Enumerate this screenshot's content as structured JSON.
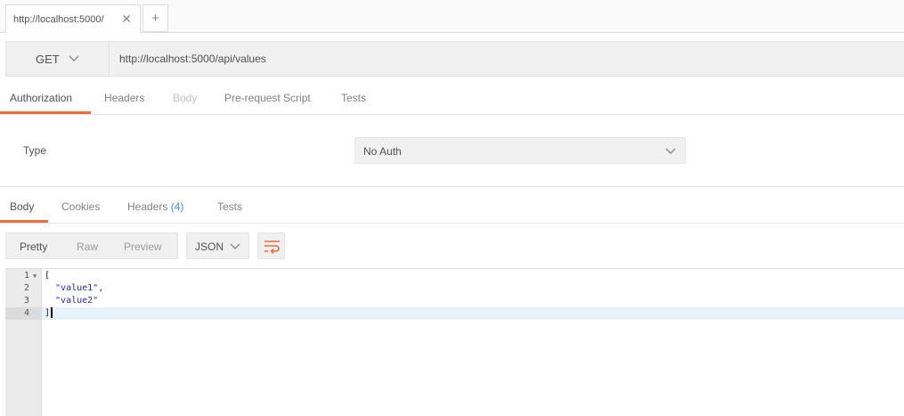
{
  "browser_tabs": [
    {
      "label": "http://localhost:5000/"
    }
  ],
  "request": {
    "method": "GET",
    "url": "http://localhost:5000/api/values"
  },
  "request_tabs": [
    "Authorization",
    "Headers",
    "Body",
    "Pre-request Script",
    "Tests"
  ],
  "auth": {
    "type_label": "Type",
    "selected": "No Auth"
  },
  "response_tabs": {
    "body": "Body",
    "cookies": "Cookies",
    "headers": "Headers",
    "headers_count": "(4)",
    "tests": "Tests"
  },
  "view_modes": [
    "Pretty",
    "Raw",
    "Preview"
  ],
  "format": "JSON",
  "response_body": {
    "line_numbers": [
      "1",
      "2",
      "3",
      "4"
    ],
    "lines": [
      "[",
      "  \"value1\",",
      "  \"value2\"",
      "]"
    ]
  },
  "colors": {
    "accent": "#f26b3a",
    "count": "#4a8fd6"
  },
  "icons": {
    "close": "close-icon",
    "new_tab": "plus-icon",
    "dropdown": "chevron-down-icon",
    "wrap": "wrap-lines-icon",
    "fold": "fold-arrow-icon"
  }
}
